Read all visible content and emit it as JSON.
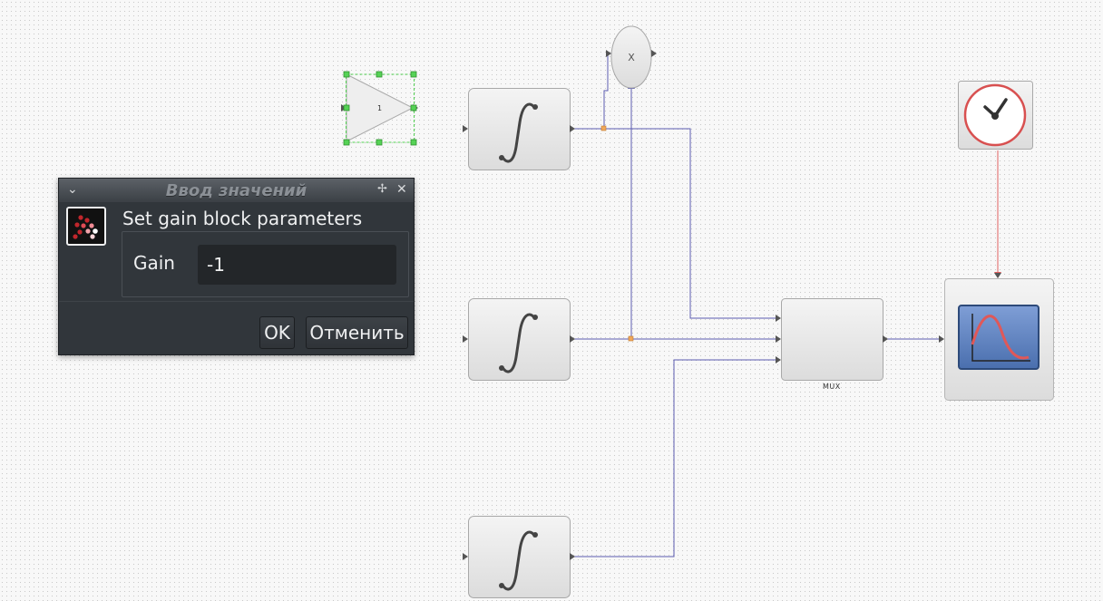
{
  "dialog": {
    "title": "Ввод значений",
    "heading": "Set gain block parameters",
    "field_label": "Gain",
    "field_value": "-1",
    "ok_label": "OK",
    "cancel_label": "Отменить"
  },
  "diagram": {
    "gain_block_value": "1",
    "product_symbol": "X",
    "mux_label": "MUX"
  },
  "colors": {
    "signal_link": "#5b5bb0",
    "event_link": "#e06060",
    "selection_handle": "#55d255",
    "split_point": "#f0a85a",
    "dialog_bg": "#31363b"
  }
}
